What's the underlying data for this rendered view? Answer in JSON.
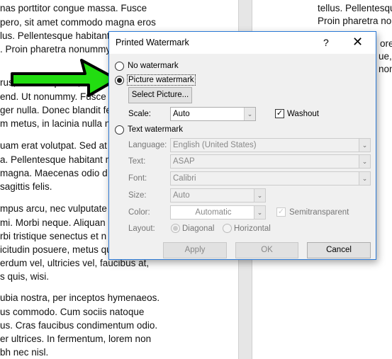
{
  "document": {
    "left_lines": [
      "nas porttitor congue massa. Fusce",
      "pero, sit amet commodo magna eros",
      "lus. Pellentesque habitant",
      ". Proin pharetra nonummy",
      "rus, scelerisque at, vu",
      "end. Ut nonummy. Fusce a",
      "ger nulla. Donec blandit fe",
      "m metus, in lacinia nulla n",
      "uam erat volutpat. Sed at",
      "a. Pellentesque habitant m",
      "magna. Maecenas odio d",
      "sagittis felis.",
      "mpus arcu, nec vulputate a",
      " mi. Morbi neque. Aliquan",
      "rbi tristique senectus et n",
      "icitudin posuere, metus qu",
      "erdum vel, ultricies vel, faucibus at,",
      "s quis, wisi.",
      "ubia nostra, per inceptos hymenaeos.",
      "us commodo. Cum sociis natoque",
      "us. Cras faucibus condimentum odio.",
      "er ultrices. In fermentum, lorem non",
      "bh nec nisl."
    ],
    "right_lines": [
      "tellus. Pellentesque",
      "Proin pharetra no",
      "orem",
      "ue, p",
      "non"
    ]
  },
  "dialog": {
    "title": "Printed Watermark",
    "help": "?",
    "close": "✕",
    "no_watermark": "No watermark",
    "picture_watermark": "Picture watermark",
    "select_picture": "Select Picture...",
    "scale_label": "Scale:",
    "scale_value": "Auto",
    "washout": "Washout",
    "washout_checked": true,
    "text_watermark": "Text watermark",
    "language_label": "Language:",
    "language_value": "English (United States)",
    "text_label": "Text:",
    "text_value": "ASAP",
    "font_label": "Font:",
    "font_value": "Calibri",
    "size_label": "Size:",
    "size_value": "Auto",
    "color_label": "Color:",
    "color_value": "Automatic",
    "semitransparent": "Semitransparent",
    "layout_label": "Layout:",
    "diagonal": "Diagonal",
    "horizontal": "Horizontal",
    "apply": "Apply",
    "ok": "OK",
    "cancel": "Cancel",
    "selected_option": "Picture watermark"
  },
  "colors": {
    "arrow": "#22dd11",
    "dialog_border": "#2b79d6"
  }
}
